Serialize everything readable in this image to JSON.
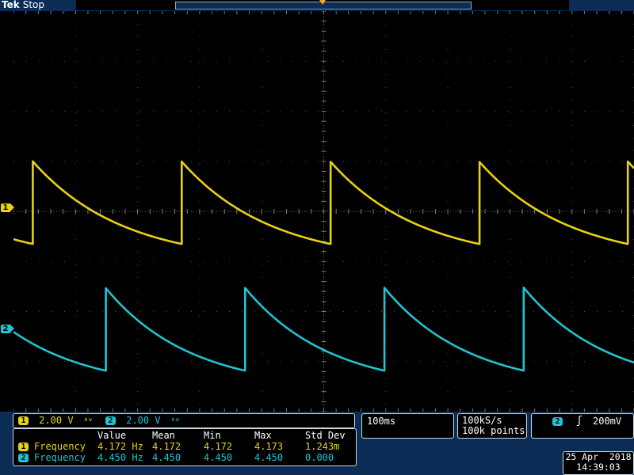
{
  "header": {
    "brand": "Tek",
    "acquisition_state": "Stop"
  },
  "colors": {
    "ch1": "#e8d213",
    "ch2": "#1fc4d0",
    "grid": "#5a5a5a",
    "panel_bg": "#0b2d55"
  },
  "channels": [
    {
      "number": "1",
      "scale": "2.00 V",
      "coupling_icon": "bandwidth-limit-icon"
    },
    {
      "number": "2",
      "scale": "2.00 V",
      "coupling_icon": "bandwidth-limit-icon"
    }
  ],
  "measurements": {
    "headers": [
      "Value",
      "Mean",
      "Min",
      "Max",
      "Std Dev"
    ],
    "rows": [
      {
        "channel": "1",
        "name": "Frequency",
        "value": "4.172 Hz",
        "mean": "4.172",
        "min": "4.172",
        "max": "4.173",
        "std_dev": "1.243m"
      },
      {
        "channel": "2",
        "name": "Frequency",
        "value": "4.450 Hz",
        "mean": "4.450",
        "min": "4.450",
        "max": "4.450",
        "std_dev": "0.000"
      }
    ]
  },
  "timebase": {
    "scale": "100ms"
  },
  "acquisition": {
    "sample_rate": "100kS/s",
    "record_length": "100k points"
  },
  "trigger": {
    "source": "2",
    "slope_icon": "rising-edge-icon",
    "slope_glyph": "ʃ",
    "level": "200mV"
  },
  "datetime": {
    "date": "25 Apr  2018",
    "time": "14:39:03"
  },
  "chart_data": {
    "type": "line",
    "grid": true,
    "divisions": {
      "x": 10,
      "y": 8
    },
    "series": [
      {
        "name": "1",
        "period_divisions": 2.397,
        "edges_x_div": [
          0.31,
          2.7,
          5.1,
          7.5
        ],
        "high_div": 1.0,
        "low_div": -0.65
      },
      {
        "name": "2",
        "period_divisions": 2.247,
        "edges_x_div": [
          1.48,
          3.73,
          5.97,
          8.22
        ],
        "high_div": -1.52,
        "low_div": -3.18
      }
    ]
  }
}
